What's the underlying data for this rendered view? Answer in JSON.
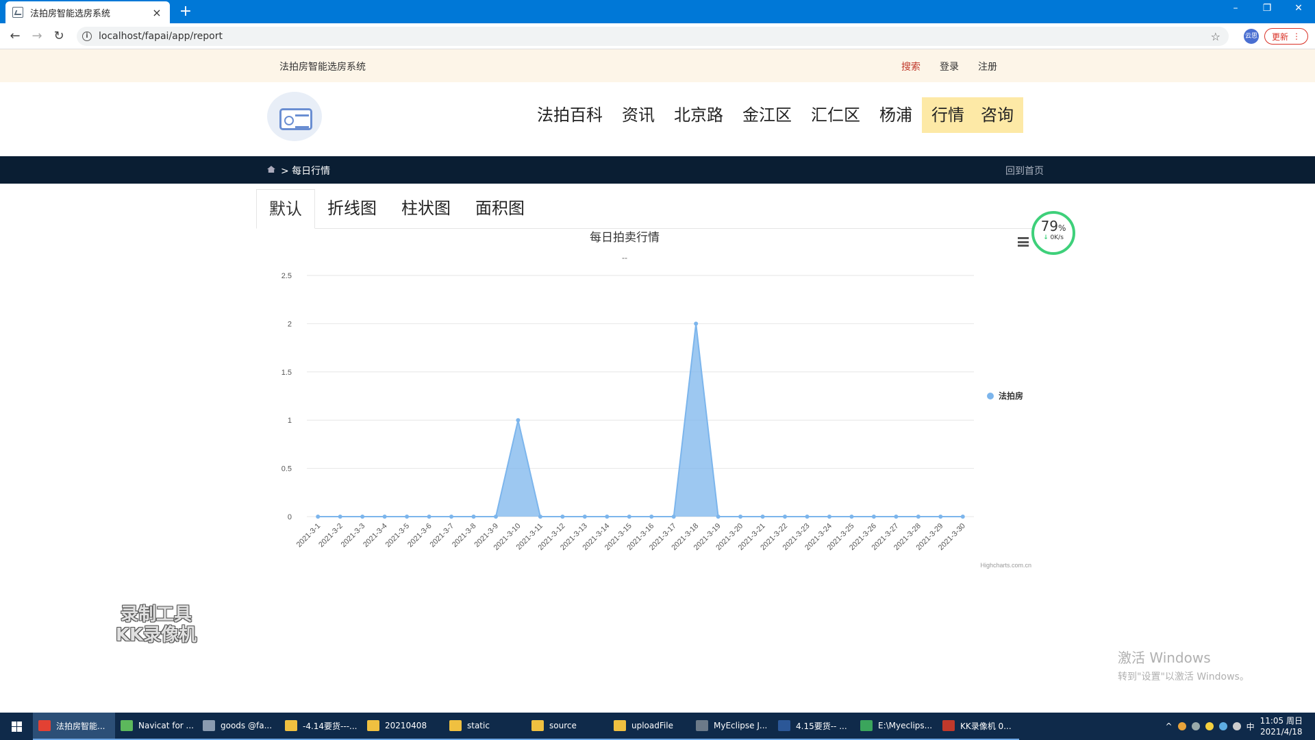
{
  "browser": {
    "tab_title": "法拍房智能选房系统",
    "tab_close": "×",
    "new_tab": "+",
    "url": "localhost/fapai/app/report",
    "info_glyph": "i",
    "star_glyph": "☆",
    "ext_label": "云思",
    "update_label": "更新",
    "update_menu": "⋮",
    "win_min": "–",
    "win_max": "❐",
    "win_close": "✕",
    "back": "←",
    "forward": "→",
    "reload": "↻"
  },
  "site": {
    "brand": "法拍房智能选房系统",
    "top_links": [
      {
        "label": "搜索",
        "hot": true
      },
      {
        "label": "登录",
        "hot": false
      },
      {
        "label": "注册",
        "hot": false
      }
    ],
    "nav": [
      {
        "label": "法拍百科",
        "active": false
      },
      {
        "label": "资讯",
        "active": false
      },
      {
        "label": "北京路",
        "active": false
      },
      {
        "label": "金江区",
        "active": false
      },
      {
        "label": "汇仁区",
        "active": false
      },
      {
        "label": "杨浦",
        "active": false
      },
      {
        "label": "行情",
        "active": true
      },
      {
        "label": "咨询",
        "active": true
      }
    ],
    "breadcrumb": "> 每日行情",
    "back_home": "回到首页"
  },
  "chart_tabs": [
    "默认",
    "折线图",
    "柱状图",
    "面积图"
  ],
  "speed_widget": {
    "percent": "79",
    "percent_unit": "%",
    "rate": "0K/s",
    "rate_arrow": "↓"
  },
  "chart_data": {
    "type": "area",
    "title": "每日拍卖行情",
    "subtitle": "--",
    "credits": "Highcharts.com.cn",
    "xlabel": "",
    "ylabel": "",
    "ylim": [
      0,
      2.5
    ],
    "yticks": [
      0,
      0.5,
      1,
      1.5,
      2,
      2.5
    ],
    "grid": true,
    "legend_position": "right",
    "categories": [
      "2021-3-1",
      "2021-3-2",
      "2021-3-3",
      "2021-3-4",
      "2021-3-5",
      "2021-3-6",
      "2021-3-7",
      "2021-3-8",
      "2021-3-9",
      "2021-3-10",
      "2021-3-11",
      "2021-3-12",
      "2021-3-13",
      "2021-3-14",
      "2021-3-15",
      "2021-3-16",
      "2021-3-17",
      "2021-3-18",
      "2021-3-19",
      "2021-3-20",
      "2021-3-21",
      "2021-3-22",
      "2021-3-23",
      "2021-3-24",
      "2021-3-25",
      "2021-3-26",
      "2021-3-27",
      "2021-3-28",
      "2021-3-29",
      "2021-3-30"
    ],
    "series": [
      {
        "name": "法拍房",
        "color": "#7cb5ec",
        "values": [
          0,
          0,
          0,
          0,
          0,
          0,
          0,
          0,
          0,
          1,
          0,
          0,
          0,
          0,
          0,
          0,
          0,
          2,
          0,
          0,
          0,
          0,
          0,
          0,
          0,
          0,
          0,
          0,
          0,
          0
        ]
      }
    ]
  },
  "overlays": {
    "recorder_watermark": [
      "录制工具",
      "KK录像机"
    ],
    "activate_title": "激活 Windows",
    "activate_hint": "转到\"设置\"以激活 Windows。"
  },
  "taskbar": {
    "items": [
      {
        "label": "法拍房智能...",
        "color": "#e34133",
        "active": true
      },
      {
        "label": "Navicat for ...",
        "color": "#5cb85c",
        "active": false
      },
      {
        "label": "goods @fa...",
        "color": "#8a9bb0",
        "active": false
      },
      {
        "label": "-4.14要货---...",
        "color": "#f0c040",
        "active": false
      },
      {
        "label": "20210408",
        "color": "#f0c040",
        "active": false
      },
      {
        "label": "static",
        "color": "#f0c040",
        "active": false
      },
      {
        "label": "source",
        "color": "#f0c040",
        "active": false
      },
      {
        "label": "uploadFile",
        "color": "#f0c040",
        "active": false
      },
      {
        "label": "MyEclipse J...",
        "color": "#6c7a89",
        "active": false
      },
      {
        "label": "4.15要货-- ...",
        "color": "#2b5797",
        "active": false
      },
      {
        "label": "E:\\Myeclips...",
        "color": "#3ba55c",
        "active": false
      },
      {
        "label": "KK录像机 0...",
        "color": "#c0392b",
        "active": false
      }
    ],
    "tray_text": "^",
    "ime": "中",
    "clock_time": "11:05 周日",
    "clock_date": "2021/4/18"
  }
}
